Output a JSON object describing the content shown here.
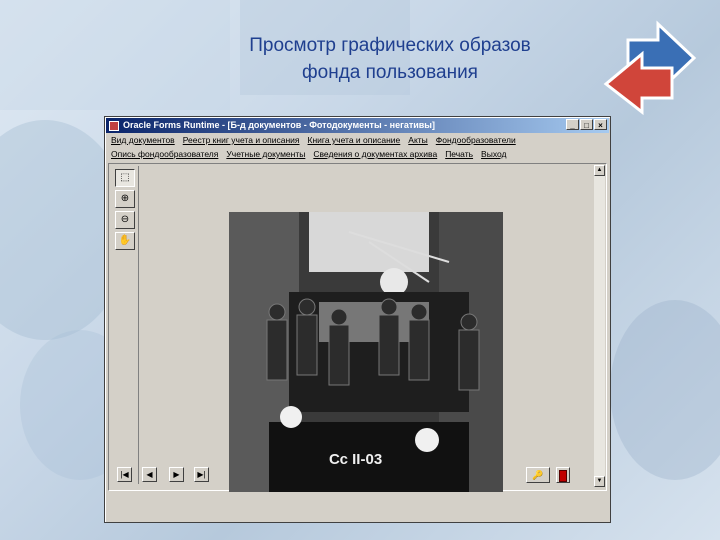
{
  "slide": {
    "title_line1": "Просмотр графических образов",
    "title_line2": "фонда пользования"
  },
  "colors": {
    "title": "#1f3f8f",
    "titlebar_start": "#0a246a",
    "titlebar_end": "#a6caf0",
    "arrow_blue": "#3a6fb5",
    "arrow_red": "#d0453a"
  },
  "window": {
    "title": "Oracle Forms Runtime - [Б-д документов - Фотодокументы - негативы]",
    "controls": [
      "minimize",
      "maximize",
      "close"
    ],
    "control_glyphs": [
      "_",
      "□",
      "×"
    ]
  },
  "menu": {
    "row1": [
      "Вид документов",
      "Реестр книг учета и описания",
      "Книга учета и описание",
      "Акты",
      "Фондообразователи"
    ],
    "row2": [
      "Опись фондообразователя",
      "Учетные документы",
      "Сведения о документах архива",
      "Печать",
      "Выход"
    ]
  },
  "toolbar": {
    "buttons": [
      {
        "icon": "select-rectangle-icon",
        "glyph": "⬚",
        "pressed": true
      },
      {
        "icon": "zoom-in-icon",
        "glyph": "⊕",
        "pressed": false
      },
      {
        "icon": "zoom-out-icon",
        "glyph": "⊖",
        "pressed": false
      },
      {
        "icon": "pan-hand-icon",
        "glyph": "✋",
        "pressed": false
      }
    ]
  },
  "photo": {
    "plate_text": "Сс II-03",
    "subject": "negative-photo-locomotive"
  },
  "scrollbar": {
    "up_glyph": "▲",
    "down_glyph": "▼"
  },
  "navigation": {
    "first": "|◀",
    "prev": "◀",
    "next": "▶",
    "last": "▶|"
  },
  "status": {
    "key_glyph": "🔑",
    "exit_icon": "exit-door-icon"
  }
}
